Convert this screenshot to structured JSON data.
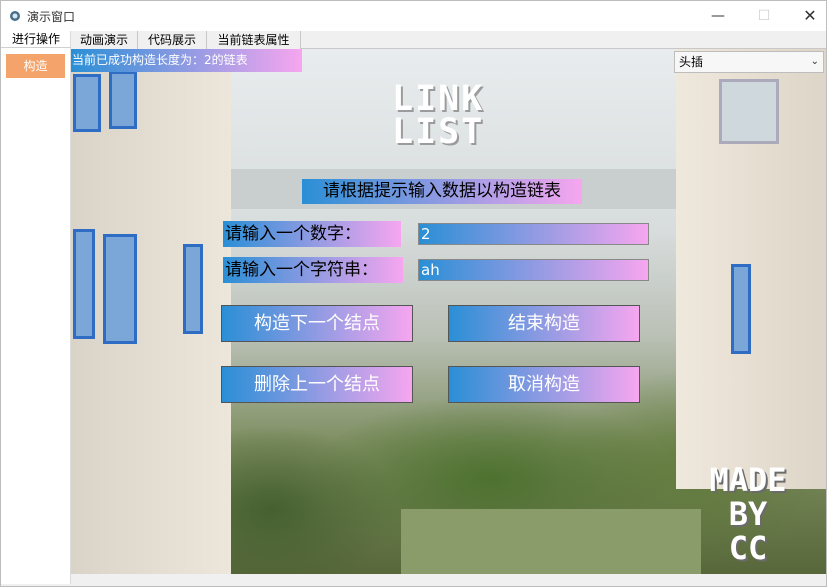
{
  "window": {
    "title": "演示窗口",
    "minimize": "—",
    "maximize": "☐",
    "close": "✕"
  },
  "sidebar": {
    "title": "进行操作",
    "button": "构造"
  },
  "tabs": [
    "动画演示",
    "代码展示",
    "当前链表属性"
  ],
  "main": {
    "status": "当前已成功构造长度为：2的链表",
    "mode_select": "头插",
    "logo_link": [
      "LINK",
      "LIST"
    ],
    "logo_made": [
      "MADE",
      "BY",
      "CC"
    ],
    "prompt": "请根据提示输入数据以构造链表",
    "number_label": "请输入一个数字：",
    "number_value": "2",
    "string_label": "请输入一个字符串：",
    "string_value": "ah",
    "buttons": {
      "next": "构造下一个结点",
      "finish": "结束构造",
      "delete_prev": "删除上一个结点",
      "cancel": "取消构造"
    }
  }
}
